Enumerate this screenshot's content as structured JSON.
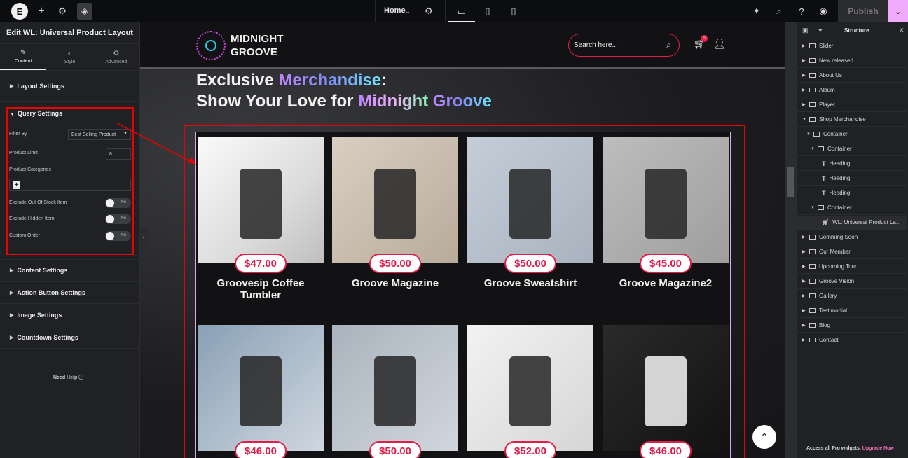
{
  "topbar": {
    "logo": "E",
    "page_select": "Home",
    "publish_label": "Publish"
  },
  "left_panel": {
    "title": "Edit WL: Universal Product Layout",
    "tabs": [
      {
        "label": "Content",
        "icon": "pencil-icon"
      },
      {
        "label": "Style",
        "icon": "contrast-icon"
      },
      {
        "label": "Advanced",
        "icon": "gear-icon"
      }
    ],
    "sections": {
      "layout": "Layout Settings",
      "query": "Query Settings",
      "content": "Content Settings",
      "action": "Action Button Settings",
      "image": "Image Settings",
      "countdown": "Countdown Settings"
    },
    "query": {
      "filter_label": "Filter By",
      "filter_value": "Best Selling Product",
      "limit_label": "Product Limit",
      "limit_value": "8",
      "categories_label": "Product Categories",
      "exclude_oos_label": "Exclude Out Of Stock Item",
      "exclude_oos_value": "No",
      "exclude_hidden_label": "Exclude Hidden Item",
      "exclude_hidden_value": "No",
      "custom_order_label": "Custom Order",
      "custom_order_value": "No"
    },
    "need_help": "Need Help"
  },
  "site": {
    "brand_line1": "MIDNIGHT",
    "brand_line2": "GROOVE",
    "search_placeholder": "Search here...",
    "cart_count": "0",
    "headline_a": "Exclusive ",
    "headline_b": "Merchandise",
    "headline_c": ":",
    "headline_d": "Show Your Love for ",
    "headline_e": "Midnight",
    "headline_f": " ",
    "headline_g": "Groove"
  },
  "products": [
    {
      "price": "$47.00",
      "title": "Groovesip Coffee Tumbler"
    },
    {
      "price": "$50.00",
      "title": "Groove Magazine"
    },
    {
      "price": "$50.00",
      "title": "Groove Sweatshirt"
    },
    {
      "price": "$45.00",
      "title": "Groove Magazine2"
    },
    {
      "price": "$46.00",
      "title": ""
    },
    {
      "price": "$50.00",
      "title": ""
    },
    {
      "price": "$52.00",
      "title": ""
    },
    {
      "price": "$46.00",
      "title": ""
    }
  ],
  "structure": {
    "title": "Structure",
    "items": [
      {
        "label": "Slider",
        "type": "container",
        "level": 0
      },
      {
        "label": "New released",
        "type": "container",
        "level": 0
      },
      {
        "label": "About Us",
        "type": "container",
        "level": 0
      },
      {
        "label": "Album",
        "type": "container",
        "level": 0
      },
      {
        "label": "Player",
        "type": "container",
        "level": 0
      },
      {
        "label": "Shop Merchandise",
        "type": "container",
        "level": 0,
        "open": true
      },
      {
        "label": "Container",
        "type": "container",
        "level": 1,
        "open": true
      },
      {
        "label": "Container",
        "type": "container",
        "level": 2,
        "open": true
      },
      {
        "label": "Heading",
        "type": "heading",
        "level": 3
      },
      {
        "label": "Heading",
        "type": "heading",
        "level": 3
      },
      {
        "label": "Heading",
        "type": "heading",
        "level": 3
      },
      {
        "label": "Container",
        "type": "container",
        "level": 2,
        "open": true
      },
      {
        "label": "WL: Universal Product La...",
        "type": "widget",
        "level": 3,
        "active": true
      },
      {
        "label": "Comming Soon",
        "type": "container",
        "level": 0
      },
      {
        "label": "Our Member",
        "type": "container",
        "level": 0
      },
      {
        "label": "Upcoming Tour",
        "type": "container",
        "level": 0
      },
      {
        "label": "Groove Vision",
        "type": "container",
        "level": 0
      },
      {
        "label": "Gallery",
        "type": "container",
        "level": 0
      },
      {
        "label": "Testimonial",
        "type": "container",
        "level": 0
      },
      {
        "label": "Blog",
        "type": "container",
        "level": 0
      },
      {
        "label": "Contact",
        "type": "container",
        "level": 0
      }
    ],
    "upgrade_text": "Access all Pro widgets.",
    "upgrade_link": "Upgrade Now"
  }
}
